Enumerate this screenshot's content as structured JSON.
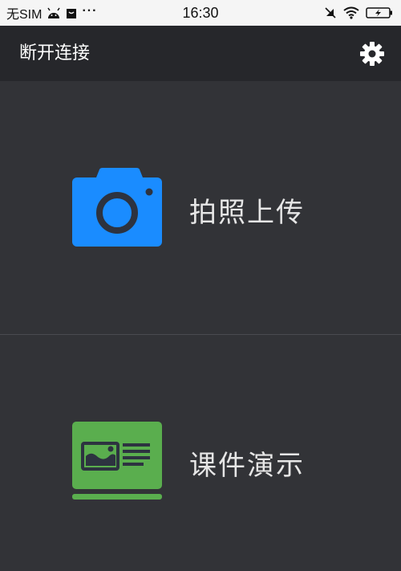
{
  "status_bar": {
    "carrier": "无SIM",
    "time": "16:30",
    "icons": [
      "android-icon",
      "bag-icon",
      "more-dots-icon",
      "mute-icon",
      "wifi-icon",
      "battery-charging-icon"
    ]
  },
  "app_bar": {
    "title": "断开连接",
    "settings_icon": "gear-icon"
  },
  "panels": [
    {
      "label": "拍照上传",
      "icon": "camera-icon",
      "icon_color": "#1a8cff"
    },
    {
      "label": "课件演示",
      "icon": "slideshow-icon",
      "icon_color": "#5aae4e"
    }
  ],
  "colors": {
    "background": "#323337",
    "app_bar": "#26272b",
    "status_bar": "#f5f5f5",
    "label_text": "#e6e6e6"
  }
}
